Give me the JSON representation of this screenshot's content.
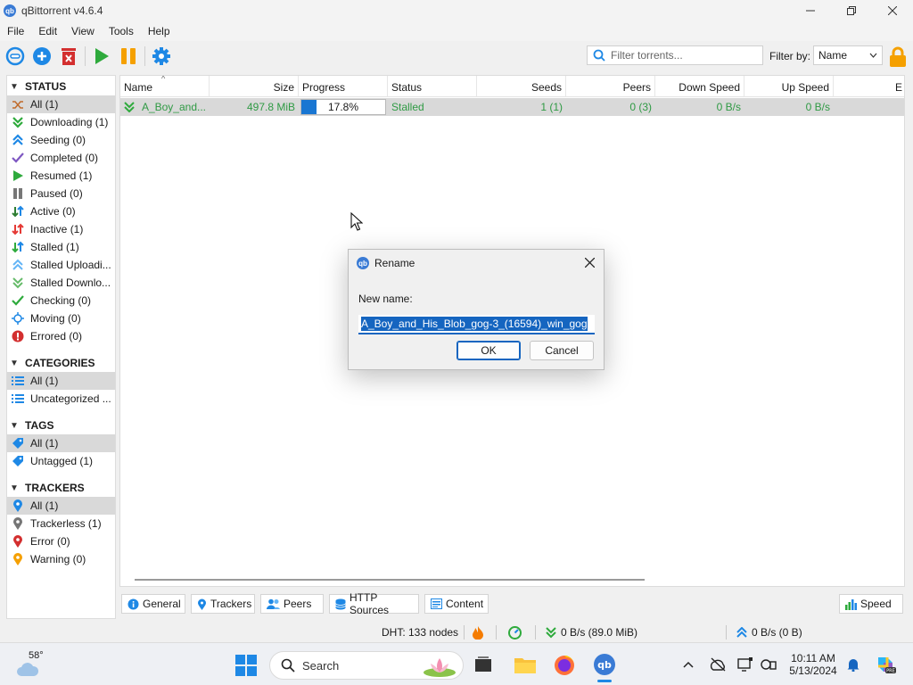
{
  "window": {
    "title": "qBittorrent v4.6.4",
    "app_icon": "qb"
  },
  "menu": [
    "File",
    "Edit",
    "View",
    "Tools",
    "Help"
  ],
  "toolbar": {
    "filter_placeholder": "Filter torrents...",
    "filter_by_label": "Filter by:",
    "filter_by_value": "Name"
  },
  "sidebar": {
    "status": {
      "header": "STATUS",
      "items": [
        {
          "label": "All (1)",
          "icon": "shuffle-icon"
        },
        {
          "label": "Downloading (1)",
          "icon": "download-icon"
        },
        {
          "label": "Seeding (0)",
          "icon": "upload-icon"
        },
        {
          "label": "Completed (0)",
          "icon": "check-icon"
        },
        {
          "label": "Resumed (1)",
          "icon": "play-icon"
        },
        {
          "label": "Paused (0)",
          "icon": "pause-icon"
        },
        {
          "label": "Active (0)",
          "icon": "active-arrows-icon"
        },
        {
          "label": "Inactive (1)",
          "icon": "inactive-arrows-icon"
        },
        {
          "label": "Stalled (1)",
          "icon": "stalled-arrows-icon"
        },
        {
          "label": "Stalled Uploadi...",
          "icon": "stalled-upload-icon"
        },
        {
          "label": "Stalled Downlo...",
          "icon": "stalled-download-icon"
        },
        {
          "label": "Checking (0)",
          "icon": "checking-icon"
        },
        {
          "label": "Moving (0)",
          "icon": "moving-icon"
        },
        {
          "label": "Errored (0)",
          "icon": "error-icon"
        }
      ]
    },
    "categories": {
      "header": "CATEGORIES",
      "items": [
        {
          "label": "All (1)",
          "icon": "list-icon"
        },
        {
          "label": "Uncategorized ...",
          "icon": "list-icon"
        }
      ]
    },
    "tags": {
      "header": "TAGS",
      "items": [
        {
          "label": "All (1)",
          "icon": "tag-icon"
        },
        {
          "label": "Untagged (1)",
          "icon": "tag-icon"
        }
      ]
    },
    "trackers": {
      "header": "TRACKERS",
      "items": [
        {
          "label": "All (1)",
          "icon": "pin-icon"
        },
        {
          "label": "Trackerless (1)",
          "icon": "pin-icon"
        },
        {
          "label": "Error (0)",
          "icon": "pin-icon"
        },
        {
          "label": "Warning (0)",
          "icon": "pin-icon"
        }
      ]
    }
  },
  "table": {
    "columns": [
      "Name",
      "Size",
      "Progress",
      "Status",
      "Seeds",
      "Peers",
      "Down Speed",
      "Up Speed",
      "E"
    ],
    "rows": [
      {
        "name": "A_Boy_and...",
        "size": "497.8 MiB",
        "progress_text": "17.8%",
        "progress": 0.178,
        "status": "Stalled",
        "seeds": "1 (1)",
        "peers": "0 (3)",
        "down": "0 B/s",
        "up": "0 B/s"
      }
    ],
    "row_color": "#2f9a44"
  },
  "tabs": [
    "General",
    "Trackers",
    "Peers",
    "HTTP Sources",
    "Content",
    "Speed"
  ],
  "statusbar": {
    "dht": "DHT: 133 nodes",
    "down": "0 B/s (89.0 MiB)",
    "up": "0 B/s (0 B)"
  },
  "dialog": {
    "title": "Rename",
    "label": "New name:",
    "value": "A_Boy_and_His_Blob_gog-3_(16594)_win_gog",
    "ok": "OK",
    "cancel": "Cancel"
  },
  "taskbar": {
    "weather": "58°",
    "search": "Search",
    "time": "10:11 AM",
    "date": "5/13/2024"
  },
  "colors": {
    "accent": "#1565c0",
    "green": "#2f9a44",
    "red": "#d32f2f",
    "orange": "#f5a000"
  }
}
